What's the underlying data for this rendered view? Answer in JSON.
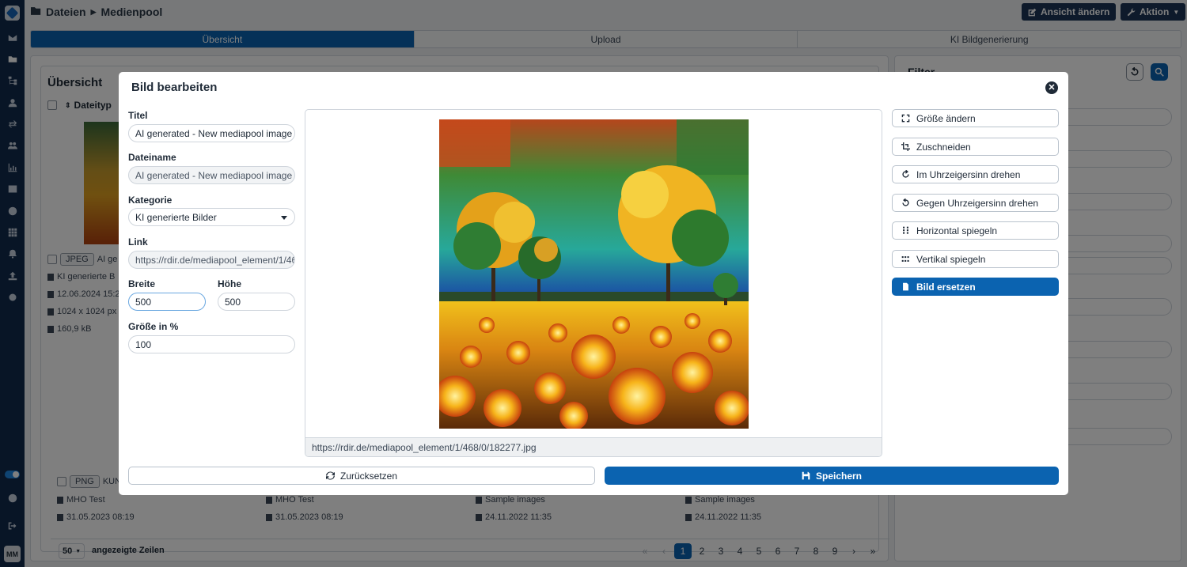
{
  "header": {
    "breadcrumb": [
      "Dateien",
      "Medienpool"
    ],
    "view_button": "Ansicht ändern",
    "action_button": "Aktion"
  },
  "sidebar": {
    "avatar": "MM"
  },
  "tabs": [
    {
      "label": "Übersicht",
      "active": true
    },
    {
      "label": "Upload",
      "active": false
    },
    {
      "label": "KI Bildgenerierung",
      "active": false
    }
  ],
  "overview": {
    "title": "Übersicht",
    "column_filetype": "Dateityp",
    "item1": {
      "type": "JPEG",
      "title_snippet": "AI ge",
      "category": "KI generierte B",
      "date": "12.06.2024 15:2",
      "dimensions": "1024 x 1024 px",
      "size": "160,9 kB"
    },
    "item2": {
      "type": "PNG",
      "title_snippet": "KUNEF"
    },
    "lower_rows": [
      {
        "category": "MHO Test",
        "date": "31.05.2023 08:19"
      },
      {
        "category": "MHO Test",
        "date": "31.05.2023 08:19"
      },
      {
        "category": "Sample images",
        "date": "24.11.2022 11:35"
      },
      {
        "category": "Sample images",
        "date": "24.11.2022 11:35"
      }
    ],
    "rows_per_page": "50",
    "rows_label": "angezeigte Zeilen",
    "pages": [
      "1",
      "2",
      "3",
      "4",
      "5",
      "6",
      "7",
      "8",
      "9"
    ],
    "current_page": "1"
  },
  "filter": {
    "title": "Filter"
  },
  "modal": {
    "title": "Bild bearbeiten",
    "labels": {
      "title": "Titel",
      "filename": "Dateiname",
      "category": "Kategorie",
      "link": "Link",
      "width": "Breite",
      "height": "Höhe",
      "scale": "Größe in %"
    },
    "values": {
      "title": "AI generated - New mediapool image",
      "filename": "AI generated - New mediapool image",
      "category": "KI generierte Bilder",
      "link": "https://rdir.de/mediapool_element/1/468/0/182277.jpg",
      "width": "500",
      "height": "500",
      "scale": "100"
    },
    "preview_url": "https://rdir.de/mediapool_element/1/468/0/182277.jpg",
    "tools": [
      {
        "label": "Größe ändern",
        "icon": "resize-icon"
      },
      {
        "label": "Zuschneiden",
        "icon": "crop-icon"
      },
      {
        "label": "Im Uhrzeigersinn drehen",
        "icon": "rotate-cw-icon"
      },
      {
        "label": "Gegen Uhrzeigersinn drehen",
        "icon": "rotate-ccw-icon"
      },
      {
        "label": "Horizontal spiegeln",
        "icon": "flip-horizontal-icon"
      },
      {
        "label": "Vertikal spiegeln",
        "icon": "flip-vertical-icon"
      },
      {
        "label": "Bild ersetzen",
        "icon": "file-replace-icon"
      }
    ],
    "reset_label": "Zurücksetzen",
    "save_label": "Speichern"
  },
  "colors": {
    "primary": "#0b63b0",
    "sidebar": "#102a4c",
    "header_button": "#1d3557"
  }
}
